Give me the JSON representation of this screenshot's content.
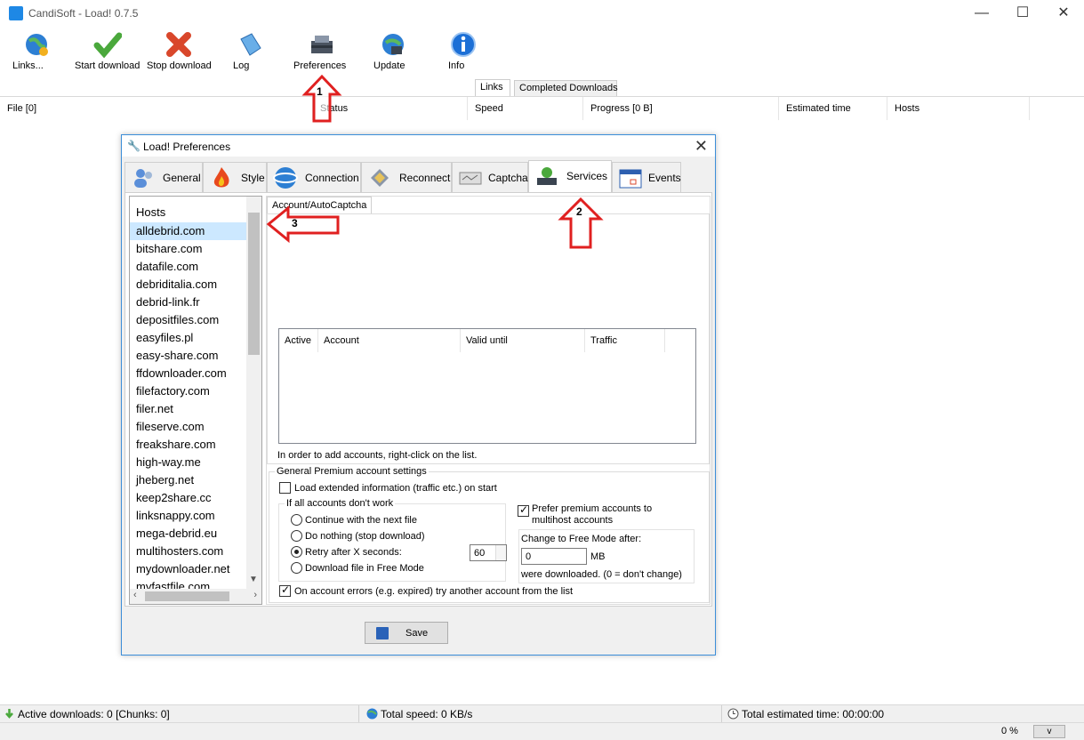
{
  "window": {
    "title": "CandiSoft - Load! 0.7.5",
    "minimize": "—",
    "maximize": "☐",
    "close": "✕"
  },
  "toolbar": [
    {
      "label": "Links...",
      "icon": "globe-icon"
    },
    {
      "label": "Start download",
      "icon": "check-icon"
    },
    {
      "label": "Stop download",
      "icon": "cross-icon"
    },
    {
      "label": "Log",
      "icon": "book-icon"
    },
    {
      "label": "Preferences",
      "icon": "toolbox-icon"
    },
    {
      "label": "Update",
      "icon": "globe-update-icon"
    },
    {
      "label": "Info",
      "icon": "info-icon"
    }
  ],
  "main_tabs": [
    "Links",
    "Completed Downloads"
  ],
  "columns": [
    "File [0]",
    "Status",
    "Speed",
    "Progress [0 B]",
    "Estimated time",
    "Hosts"
  ],
  "status": {
    "active": "Active downloads: 0 [Chunks: 0]",
    "speed": "Total speed: 0 KB/s",
    "estimated": "Total estimated time: 00:00:00",
    "percent": "0 %",
    "dropdown": "v"
  },
  "dialog": {
    "title": "Load! Preferences",
    "close": "✕",
    "tabs": [
      "General",
      "Style",
      "Connection",
      "Reconnect",
      "Captcha",
      "Services",
      "Events"
    ],
    "hosts_title": "Hosts",
    "hosts": [
      "alldebrid.com",
      "bitshare.com",
      "datafile.com",
      "debriditalia.com",
      "debrid-link.fr",
      "depositfiles.com",
      "easyfiles.pl",
      "easy-share.com",
      "ffdownloader.com",
      "filefactory.com",
      "filer.net",
      "fileserve.com",
      "freakshare.com",
      "high-way.me",
      "jheberg.net",
      "keep2share.cc",
      "linksnappy.com",
      "mega-debrid.eu",
      "multihosters.com",
      "mydownloader.net",
      "myfastfile.com"
    ],
    "subtab": "Account/AutoCaptcha",
    "account_columns": [
      "Active",
      "Account",
      "Valid until",
      "Traffic"
    ],
    "hint": "In order to add accounts, right-click on the list.",
    "general_legend": "General Premium account settings",
    "load_extended": "Load extended information (traffic etc.) on start",
    "if_all_legend": "If all accounts don't work",
    "radio": [
      "Continue with the next file",
      "Do nothing (stop download)",
      "Retry after X seconds:",
      "Download file in Free Mode"
    ],
    "retry_value": "60",
    "prefer_premium": "Prefer premium accounts to multihost accounts",
    "free_mode_legend": "Change to Free Mode after:",
    "free_mode_value": "0",
    "free_mode_unit": "MB",
    "free_mode_note": "were downloaded. (0 = don't change)",
    "on_error": "On account errors (e.g. expired) try another account from the list",
    "save": "Save"
  },
  "annotations": [
    "1",
    "2",
    "3"
  ],
  "colors": {
    "accent": "#3c8ed9",
    "annotation": "#e02020",
    "selection": "#cce8ff"
  }
}
